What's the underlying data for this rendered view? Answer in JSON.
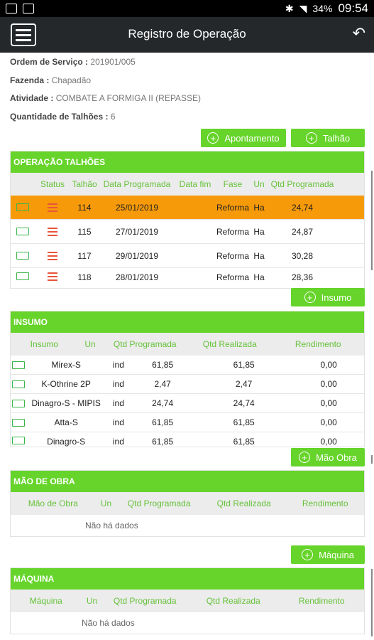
{
  "status": {
    "time": "09:54",
    "battery": "34%"
  },
  "appbar": {
    "title": "Registro de Operação"
  },
  "info": {
    "ordem_label": "Ordem de Serviço :",
    "ordem_value": "201901/005",
    "fazenda_label": "Fazenda :",
    "fazenda_value": "Chapadão",
    "atividade_label": "Atividade :",
    "atividade_value": "COMBATE A FORMIGA II (REPASSE)",
    "qtd_label": "Quantidade de Talhões :",
    "qtd_value": "6"
  },
  "buttons": {
    "apontamento": "Apontamento",
    "talhao": "Talhão",
    "insumo": "Insumo",
    "mao_obra": "Mão Obra",
    "maquina": "Máquina"
  },
  "operacao": {
    "title": "OPERAÇÃO TALHÕES",
    "headers": [
      "Status",
      "Talhão",
      "Data Programada",
      "Data fim",
      "Fase",
      "Un",
      "Qtd Programada"
    ],
    "rows": [
      {
        "talhao": "114",
        "data": "25/01/2019",
        "fim": "",
        "fase": "Reforma",
        "un": "Ha",
        "qtd": "24,74"
      },
      {
        "talhao": "115",
        "data": "27/01/2019",
        "fim": "",
        "fase": "Reforma",
        "un": "Ha",
        "qtd": "24,87"
      },
      {
        "talhao": "117",
        "data": "29/01/2019",
        "fim": "",
        "fase": "Reforma",
        "un": "Ha",
        "qtd": "30,28"
      },
      {
        "talhao": "118",
        "data": "28/01/2019",
        "fim": "",
        "fase": "Reforma",
        "un": "Ha",
        "qtd": "28,36"
      }
    ]
  },
  "insumo": {
    "title": "INSUMO",
    "headers": [
      "Insumo",
      "Un",
      "Qtd Programada",
      "Qtd Realizada",
      "Rendimento"
    ],
    "rows": [
      {
        "nome": "Mirex-S",
        "un": "ind",
        "prog": "61,85",
        "real": "61,85",
        "rend": "0,00"
      },
      {
        "nome": "K-Othrine 2P",
        "un": "ind",
        "prog": "2,47",
        "real": "2,47",
        "rend": "0,00"
      },
      {
        "nome": "Dinagro-S - MIPIS",
        "un": "ind",
        "prog": "24,74",
        "real": "24,74",
        "rend": "0,00"
      },
      {
        "nome": "Atta-S",
        "un": "ind",
        "prog": "61,85",
        "real": "61,85",
        "rend": "0,00"
      },
      {
        "nome": "Dinagro-S",
        "un": "ind",
        "prog": "61,85",
        "real": "61,85",
        "rend": "0,00"
      }
    ]
  },
  "mao_obra": {
    "title": "MÃO DE OBRA",
    "headers": [
      "Mão de Obra",
      "Un",
      "Qtd Programada",
      "Qtd Realizada",
      "Rendimento"
    ],
    "empty": "Não há dados"
  },
  "maquina": {
    "title": "MÁQUINA",
    "headers": [
      "Máquina",
      "Un",
      "Qtd Programada",
      "Qtd Realizada",
      "Rendimento"
    ],
    "empty": "Não há dados"
  }
}
